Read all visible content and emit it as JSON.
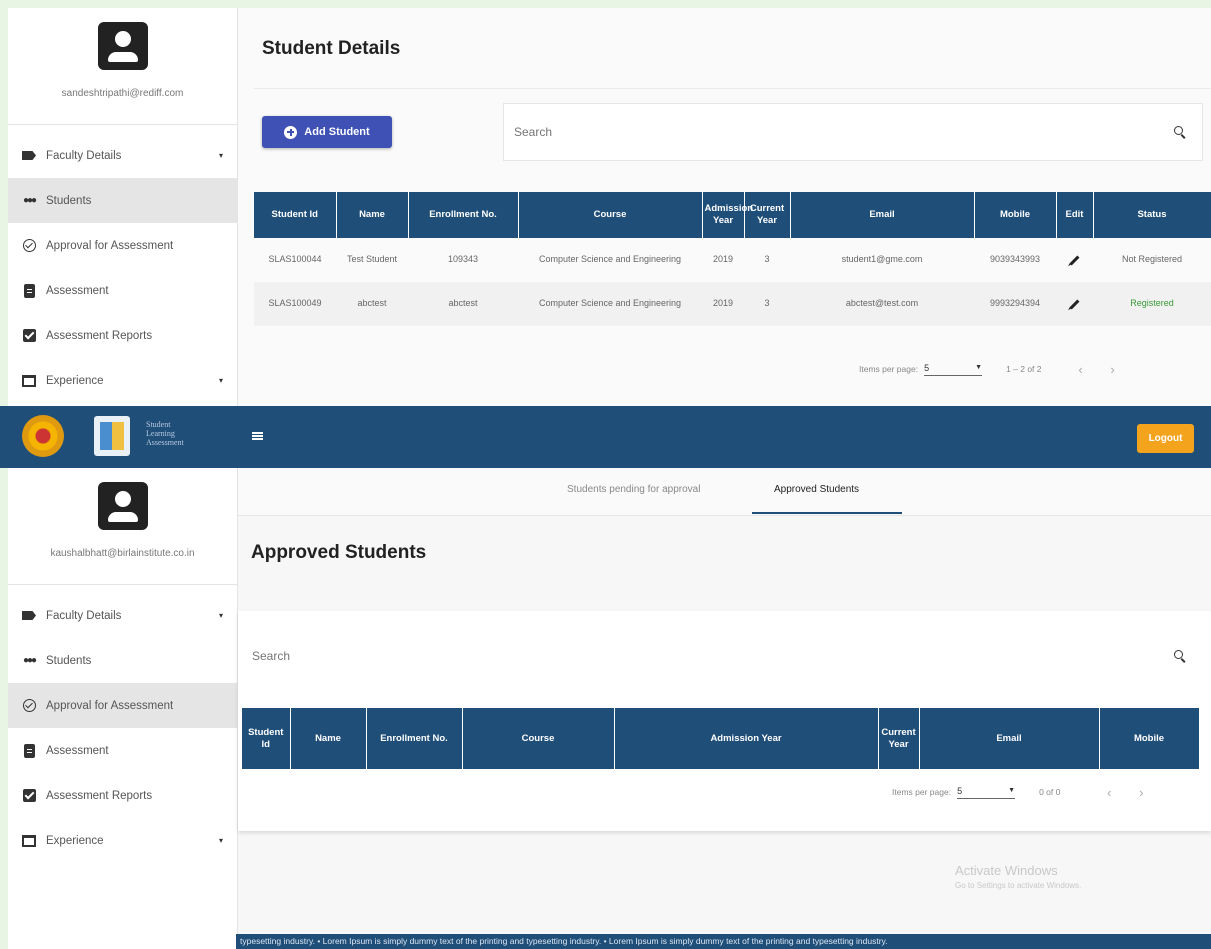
{
  "top": {
    "profile": {
      "email": "sandeshtripathi@rediff.com"
    },
    "menu": [
      {
        "label": "Faculty Details",
        "icon": "label-icon",
        "caret": "▾"
      },
      {
        "label": "Students",
        "icon": "people-icon"
      },
      {
        "label": "Approval for Assessment",
        "icon": "check-circle-icon"
      },
      {
        "label": "Assessment",
        "icon": "assignment-icon"
      },
      {
        "label": "Assessment Reports",
        "icon": "checkbox-icon"
      },
      {
        "label": "Experience",
        "icon": "book-icon",
        "caret": "▾"
      }
    ],
    "page_title": "Student Details",
    "add_button": "Add Student",
    "search_placeholder": "Search",
    "table": {
      "headers": [
        "Student Id",
        "Name",
        "Enrollment No.",
        "Course",
        "Admission Year",
        "Current Year",
        "Email",
        "Mobile",
        "Edit",
        "Status"
      ],
      "rows": [
        [
          "SLAS100044",
          "Test Student",
          "109343",
          "Computer Science and Engineering",
          "2019",
          "3",
          "student1@gme.com",
          "9039343993",
          "",
          "Not Registered"
        ],
        [
          "SLAS100049",
          "abctest",
          "abctest",
          "Computer Science and Engineering",
          "2019",
          "3",
          "abctest@test.com",
          "9993294394",
          "",
          "Registered"
        ]
      ]
    },
    "paginator": {
      "label": "Items per page:",
      "page_size": "5",
      "range": "1 – 2 of 2"
    }
  },
  "navbar": {
    "logo_text": [
      "Student",
      "Learning",
      "Assessment"
    ],
    "logout": "Logout",
    "colors": {
      "navbar": "#1f4e79",
      "logout": "#f3a31c",
      "primary_button": "#3f51b5"
    }
  },
  "bottom": {
    "profile": {
      "email": "kaushalbhatt@birlainstitute.co.in"
    },
    "menu": [
      {
        "label": "Faculty Details",
        "caret": "▾"
      },
      {
        "label": "Students"
      },
      {
        "label": "Approval for Assessment"
      },
      {
        "label": "Assessment"
      },
      {
        "label": "Assessment Reports"
      },
      {
        "label": "Experience",
        "caret": "▾"
      }
    ],
    "tabs": [
      "Students pending for approval",
      "Approved Students"
    ],
    "active_tab": "Approved Students",
    "page_title": "Approved Students",
    "search_placeholder": "Search",
    "table": {
      "headers": [
        "Student Id",
        "Name",
        "Enrollment No.",
        "Course",
        "Admission Year",
        "Current Year",
        "Email",
        "Mobile"
      ],
      "rows": []
    },
    "paginator": {
      "label": "Items per page:",
      "page_size": "5",
      "range": "0 of 0"
    },
    "watermark": {
      "line1": "Activate Windows",
      "line2": "Go to Settings to activate Windows."
    },
    "ticker": "typesetting industry.     • Lorem Ipsum is simply dummy text of the printing and typesetting industry.     • Lorem Ipsum is simply dummy text of the printing and typesetting industry."
  }
}
